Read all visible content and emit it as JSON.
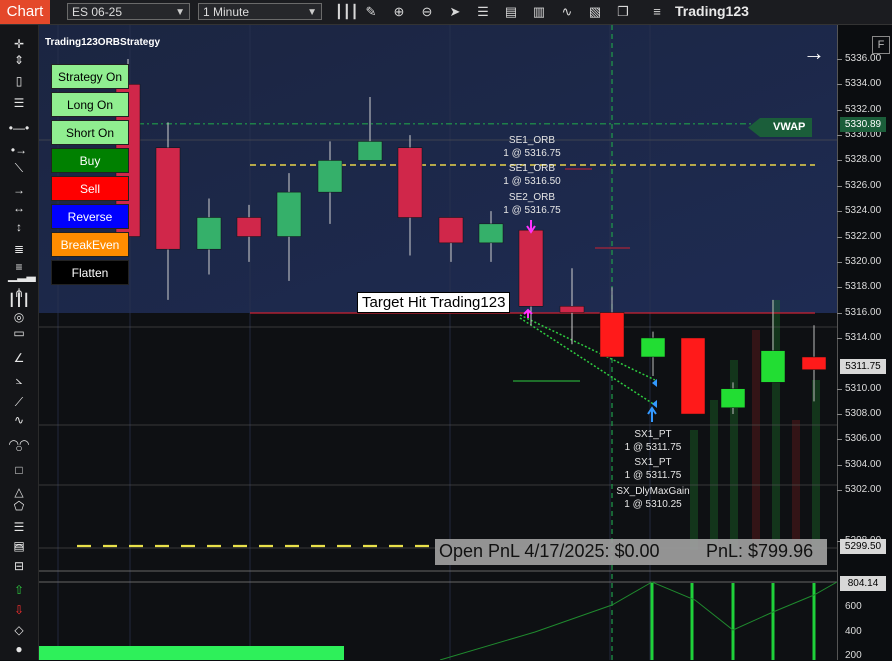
{
  "toolbar": {
    "chart_tab": "Chart",
    "instrument": "ES 06-25",
    "interval": "1 Minute",
    "title": "Trading123",
    "icons": [
      "bar-type-icon",
      "pencil-icon",
      "zoom-in-icon",
      "zoom-out-icon",
      "cursor-icon",
      "properties-icon",
      "strategy-icon",
      "indicators-icon",
      "trend-icon",
      "template-icon",
      "copy-icon",
      "menu-icon"
    ]
  },
  "strategy_title": "Trading123ORBStrategy",
  "panel_buttons": [
    {
      "label": "Strategy On",
      "bg": "#90ee90",
      "fg": "#000000"
    },
    {
      "label": "Long On",
      "bg": "#90ee90",
      "fg": "#000000"
    },
    {
      "label": "Short On",
      "bg": "#90ee90",
      "fg": "#000000"
    },
    {
      "label": "Buy",
      "bg": "#008000",
      "fg": "#ffffff"
    },
    {
      "label": "Sell",
      "bg": "#ff0000",
      "fg": "#ffffff"
    },
    {
      "label": "Reverse",
      "bg": "#0000ff",
      "fg": "#ffffff"
    },
    {
      "label": "BreakEven",
      "bg": "#ff8c00",
      "fg": "#ffffff"
    },
    {
      "label": "Flatten",
      "bg": "#000000",
      "fg": "#ffffff"
    }
  ],
  "annotations": {
    "se1_a": "SE1_ORB",
    "se1_a_qty": "1 @ 5316.75",
    "se1_b": "SE1_ORB",
    "se1_b_qty": "1 @ 5316.50",
    "se2": "SE2_ORB",
    "se2_qty": "1 @ 5316.75",
    "sx1_a": "SX1_PT",
    "sx1_a_qty": "1 @ 5311.75",
    "sx1_b": "SX1_PT",
    "sx1_b_qty": "1 @ 5311.75",
    "sx_dly": "SX_DlyMaxGain",
    "sx_dly_qty": "1 @ 5310.25",
    "target_hit": "Target Hit Trading123"
  },
  "pnl": {
    "open": "Open PnL 4/17/2025: $0.00",
    "total": "PnL: $799.96"
  },
  "vwap": {
    "label": "VWAP",
    "value": "5330.89"
  },
  "price_axis": {
    "labels": [
      "5336.00",
      "5334.00",
      "5332.00",
      "5330.00",
      "5328.00",
      "5326.00",
      "5324.00",
      "5322.00",
      "5320.00",
      "5318.00",
      "5316.00",
      "5314.00",
      "5310.00",
      "5308.00",
      "5306.00",
      "5304.00",
      "5302.00",
      "5298.00"
    ],
    "current_price": "5311.75",
    "vwap_price": "5330.89",
    "pnl_line_price": "5299.50"
  },
  "volume_axis": {
    "labels": [
      "600",
      "400",
      "200"
    ],
    "current": "804.14"
  },
  "chart_data": {
    "type": "candlestick",
    "instrument": "ES 06-25",
    "interval": "1 Minute",
    "ylim": [
      5297,
      5337
    ],
    "candles": [
      {
        "o": 5334,
        "h": 5336,
        "l": 5322,
        "c": 5322,
        "dir": "down"
      },
      {
        "o": 5329,
        "h": 5331,
        "l": 5317,
        "c": 5321,
        "dir": "down"
      },
      {
        "o": 5321,
        "h": 5325,
        "l": 5319,
        "c": 5323.5,
        "dir": "up"
      },
      {
        "o": 5323.5,
        "h": 5324.5,
        "l": 5320,
        "c": 5322,
        "dir": "down"
      },
      {
        "o": 5322,
        "h": 5327,
        "l": 5318.5,
        "c": 5325.5,
        "dir": "up"
      },
      {
        "o": 5325.5,
        "h": 5329.5,
        "l": 5323,
        "c": 5328,
        "dir": "up"
      },
      {
        "o": 5328,
        "h": 5333,
        "l": 5328,
        "c": 5329.5,
        "dir": "up"
      },
      {
        "o": 5329,
        "h": 5330,
        "l": 5320.5,
        "c": 5323.5,
        "dir": "down"
      },
      {
        "o": 5323.5,
        "h": 5323.5,
        "l": 5320,
        "c": 5321.5,
        "dir": "down"
      },
      {
        "o": 5321.5,
        "h": 5324,
        "l": 5320,
        "c": 5323,
        "dir": "up"
      },
      {
        "o": 5322.5,
        "h": 5322.5,
        "l": 5315,
        "c": 5316.5,
        "dir": "down"
      },
      {
        "o": 5316.5,
        "h": 5319.5,
        "l": 5313.5,
        "c": 5316,
        "dir": "down"
      },
      {
        "o": 5316,
        "h": 5318,
        "l": 5312.5,
        "c": 5312.5,
        "dir": "down"
      },
      {
        "o": 5312.5,
        "h": 5314.5,
        "l": 5311,
        "c": 5314,
        "dir": "up"
      },
      {
        "o": 5314,
        "h": 5314,
        "l": 5308,
        "c": 5308,
        "dir": "down"
      },
      {
        "o": 5308.5,
        "h": 5310.5,
        "l": 5308,
        "c": 5310,
        "dir": "up"
      },
      {
        "o": 5310.5,
        "h": 5317,
        "l": 5310.5,
        "c": 5313,
        "dir": "up"
      },
      {
        "o": 5312.5,
        "h": 5315,
        "l": 5309,
        "c": 5311.5,
        "dir": "down"
      }
    ],
    "vwap": 5330.89,
    "current_price": 5311.75
  }
}
